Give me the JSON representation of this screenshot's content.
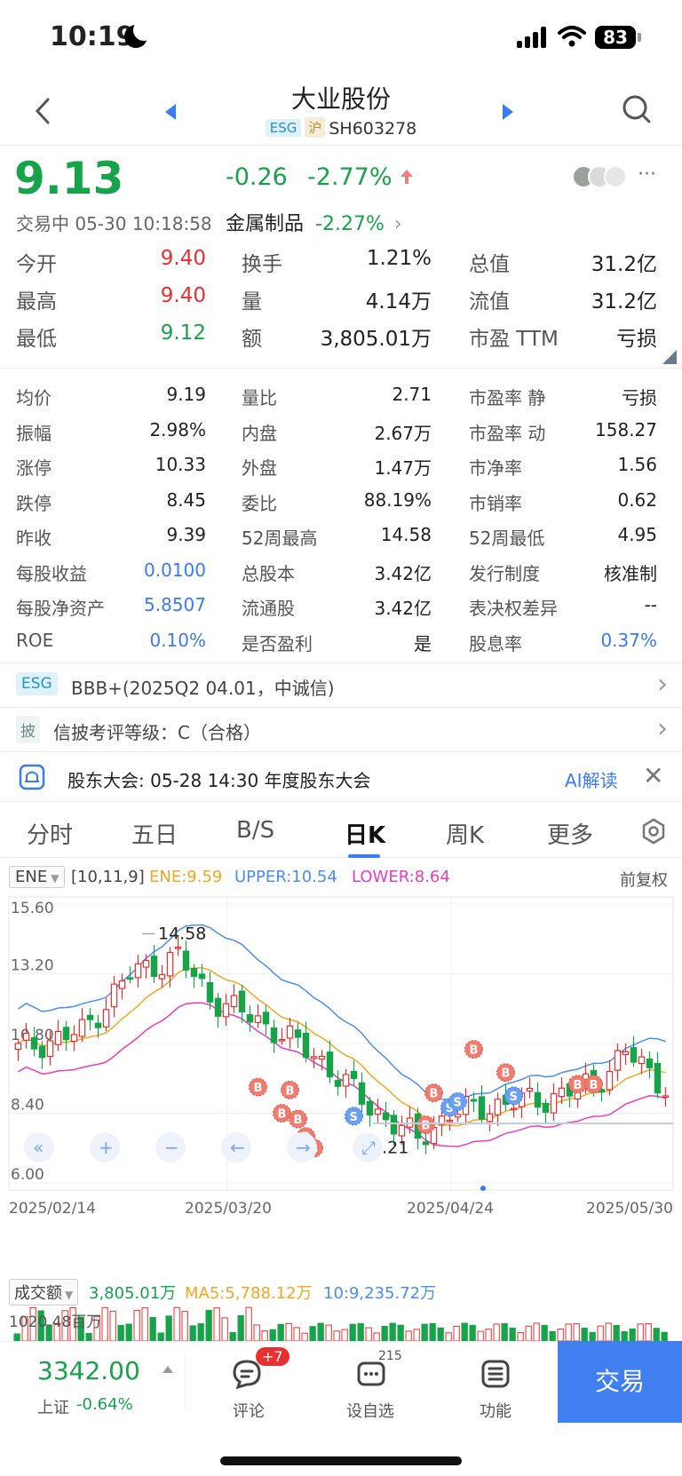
{
  "status_bar": {
    "time": "10:19",
    "battery": "83"
  },
  "header": {
    "title": "大业股份",
    "tag_esg": "ESG",
    "tag_market": "沪",
    "code": "SH603278"
  },
  "quote": {
    "price": "9.13",
    "change": "-0.26",
    "change_pct": "-2.77%",
    "status": "交易中 05-30 10:18:58",
    "sector": "金属制品",
    "sector_pct": "-2.27%"
  },
  "stats_main": [
    [
      {
        "label": "今开",
        "value": "9.40",
        "color": "red"
      },
      {
        "label": "换手",
        "value": "1.21%",
        "color": "black"
      },
      {
        "label": "总值",
        "value": "31.2亿",
        "color": "black"
      }
    ],
    [
      {
        "label": "最高",
        "value": "9.40",
        "color": "red"
      },
      {
        "label": "量",
        "value": "4.14万",
        "color": "black"
      },
      {
        "label": "流值",
        "value": "31.2亿",
        "color": "black"
      }
    ],
    [
      {
        "label": "最低",
        "value": "9.12",
        "color": "green"
      },
      {
        "label": "额",
        "value": "3,805.01万",
        "color": "black"
      },
      {
        "label": "市盈 TTM",
        "value": "亏损",
        "color": "black"
      }
    ]
  ],
  "stats_more": [
    [
      {
        "label": "均价",
        "value": "9.19",
        "color": "black"
      },
      {
        "label": "量比",
        "value": "2.71",
        "color": "black"
      },
      {
        "label": "市盈率 静",
        "value": "亏损",
        "color": "black"
      }
    ],
    [
      {
        "label": "振幅",
        "value": "2.98%",
        "color": "black"
      },
      {
        "label": "内盘",
        "value": "2.67万",
        "color": "black"
      },
      {
        "label": "市盈率 动",
        "value": "158.27",
        "color": "black"
      }
    ],
    [
      {
        "label": "涨停",
        "value": "10.33",
        "color": "black"
      },
      {
        "label": "外盘",
        "value": "1.47万",
        "color": "black"
      },
      {
        "label": "市净率",
        "value": "1.56",
        "color": "black"
      }
    ],
    [
      {
        "label": "跌停",
        "value": "8.45",
        "color": "black"
      },
      {
        "label": "委比",
        "value": "88.19%",
        "color": "black"
      },
      {
        "label": "市销率",
        "value": "0.62",
        "color": "black"
      }
    ],
    [
      {
        "label": "昨收",
        "value": "9.39",
        "color": "black"
      },
      {
        "label": "52周最高",
        "value": "14.58",
        "color": "black"
      },
      {
        "label": "52周最低",
        "value": "4.95",
        "color": "black"
      }
    ],
    [
      {
        "label": "每股收益",
        "value": "0.0100",
        "color": "blue"
      },
      {
        "label": "总股本",
        "value": "3.42亿",
        "color": "black"
      },
      {
        "label": "发行制度",
        "value": "核准制",
        "color": "black"
      }
    ],
    [
      {
        "label": "每股净资产",
        "value": "5.8507",
        "color": "blue"
      },
      {
        "label": "流通股",
        "value": "3.42亿",
        "color": "black"
      },
      {
        "label": "表决权差异",
        "value": "--",
        "color": "black"
      }
    ],
    [
      {
        "label": "ROE",
        "value": "0.10%",
        "color": "blue"
      },
      {
        "label": "是否盈利",
        "value": "是",
        "color": "black"
      },
      {
        "label": "股息率",
        "value": "0.37%",
        "color": "blue"
      }
    ]
  ],
  "banners": {
    "esg_tag": "ESG",
    "esg_text": "BBB+(2025Q2 04.01，中诚信)",
    "disclosure_tag": "披",
    "disclosure_text": "信披考评等级：C（合格）",
    "meeting_text": "股东大会: 05-28 14:30 年度股东大会",
    "ai_label": "AI解读"
  },
  "tabs": [
    "分时",
    "五日",
    "B/S",
    "日K",
    "周K",
    "更多"
  ],
  "active_tab": "日K",
  "indicator": {
    "name": "ENE",
    "params": "[10,11,9]",
    "ene": "ENE:9.59",
    "upper": "UPPER:10.54",
    "lower": "LOWER:8.64",
    "adjust": "前复权"
  },
  "chart_data": {
    "type": "candlestick",
    "y_ticks": [
      "15.60",
      "13.20",
      "10.80",
      "8.40",
      "6.00"
    ],
    "ylim": [
      6.0,
      15.6
    ],
    "x_ticks": [
      "2025/02/14",
      "2025/03/20",
      "2025/04/24",
      "2025/05/30"
    ],
    "high_label": "14.58",
    "low_label": "7.21",
    "colors": {
      "up": "#e93030",
      "down": "#17a349",
      "ene": "#f5a623",
      "upper": "#4a8ef0",
      "lower": "#e83ec0"
    }
  },
  "volume": {
    "label": "成交额",
    "value": "3,805.01万",
    "ma5": "MA5:5,788.12万",
    "ma10": "10:9,235.72万",
    "max_label": "1020.48百万"
  },
  "bottom_bar": {
    "index_value": "3342.00",
    "index_name": "上证",
    "index_pct": "-0.64%",
    "comment_label": "评论",
    "comment_badge": "+7",
    "watch_label": "设自选",
    "watch_count": "215",
    "func_label": "功能",
    "trade_label": "交易"
  }
}
